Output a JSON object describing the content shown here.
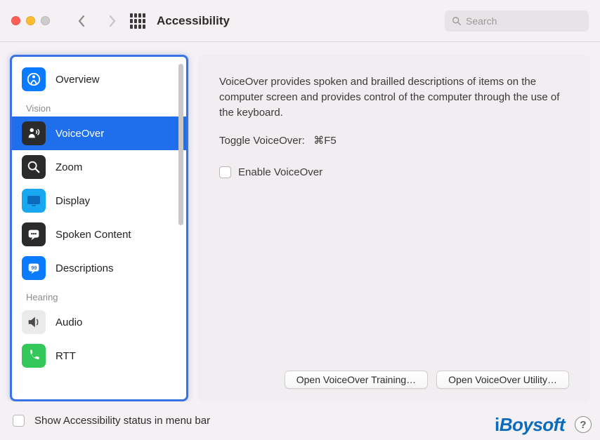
{
  "toolbar": {
    "title": "Accessibility",
    "search_placeholder": "Search"
  },
  "sidebar": {
    "overview": "Overview",
    "section_vision": "Vision",
    "voiceover": "VoiceOver",
    "zoom": "Zoom",
    "display": "Display",
    "spoken_content": "Spoken Content",
    "descriptions": "Descriptions",
    "section_hearing": "Hearing",
    "audio": "Audio",
    "rtt": "RTT"
  },
  "pane": {
    "description": "VoiceOver provides spoken and brailled descriptions of items on the computer screen and provides control of the computer through the use of the keyboard.",
    "toggle_label": "Toggle VoiceOver:",
    "toggle_shortcut": "⌘F5",
    "enable_label": "Enable VoiceOver",
    "btn_training": "Open VoiceOver Training…",
    "btn_utility": "Open VoiceOver Utility…"
  },
  "footer": {
    "menubar_label": "Show Accessibility status in menu bar"
  },
  "brand": "iBoysoft",
  "help": "?"
}
